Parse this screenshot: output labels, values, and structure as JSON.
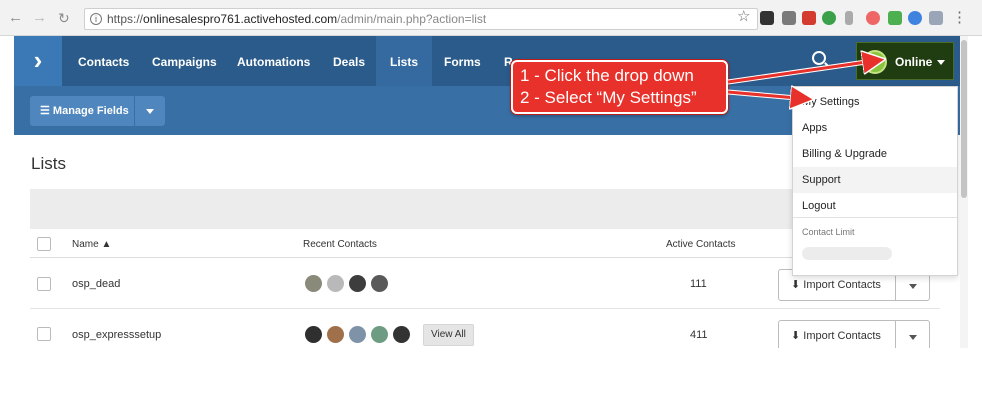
{
  "browser": {
    "url_scheme": "https://",
    "url_host": "onlinesalespro761.activehosted.com",
    "url_path": "/admin/main.php?action=list"
  },
  "nav": {
    "items": [
      "Contacts",
      "Campaigns",
      "Automations",
      "Deals",
      "Lists",
      "Forms",
      "R"
    ],
    "active": "Lists",
    "status_label": "Online"
  },
  "subbar": {
    "manage_fields_label": "☰ Manage Fields"
  },
  "page": {
    "title": "Lists"
  },
  "table": {
    "headers": {
      "name": "Name ▲",
      "recent": "Recent Contacts",
      "active": "Active Contacts"
    },
    "rows": [
      {
        "name": "osp_dead",
        "count": "111",
        "import_label": "⬇ Import Contacts",
        "view_all": ""
      },
      {
        "name": "osp_expresssetup",
        "count": "411",
        "import_label": "⬇ Import Contacts",
        "view_all": "View All"
      }
    ]
  },
  "dropdown": {
    "items": [
      "My Settings",
      "Apps",
      "Billing & Upgrade",
      "Support",
      "Logout"
    ],
    "highlighted": "My Settings",
    "contact_limit_label": "Contact Limit"
  },
  "annotation": {
    "line1": "1 - Click the drop down",
    "line2": "2 - Select “My Settings”",
    "color": "#e8312a"
  },
  "colors": {
    "nav_bg": "#2b5b8a",
    "subbar_bg": "#3870a6",
    "online_bg": "#1f3d10",
    "highlight": "#f6f62a"
  }
}
